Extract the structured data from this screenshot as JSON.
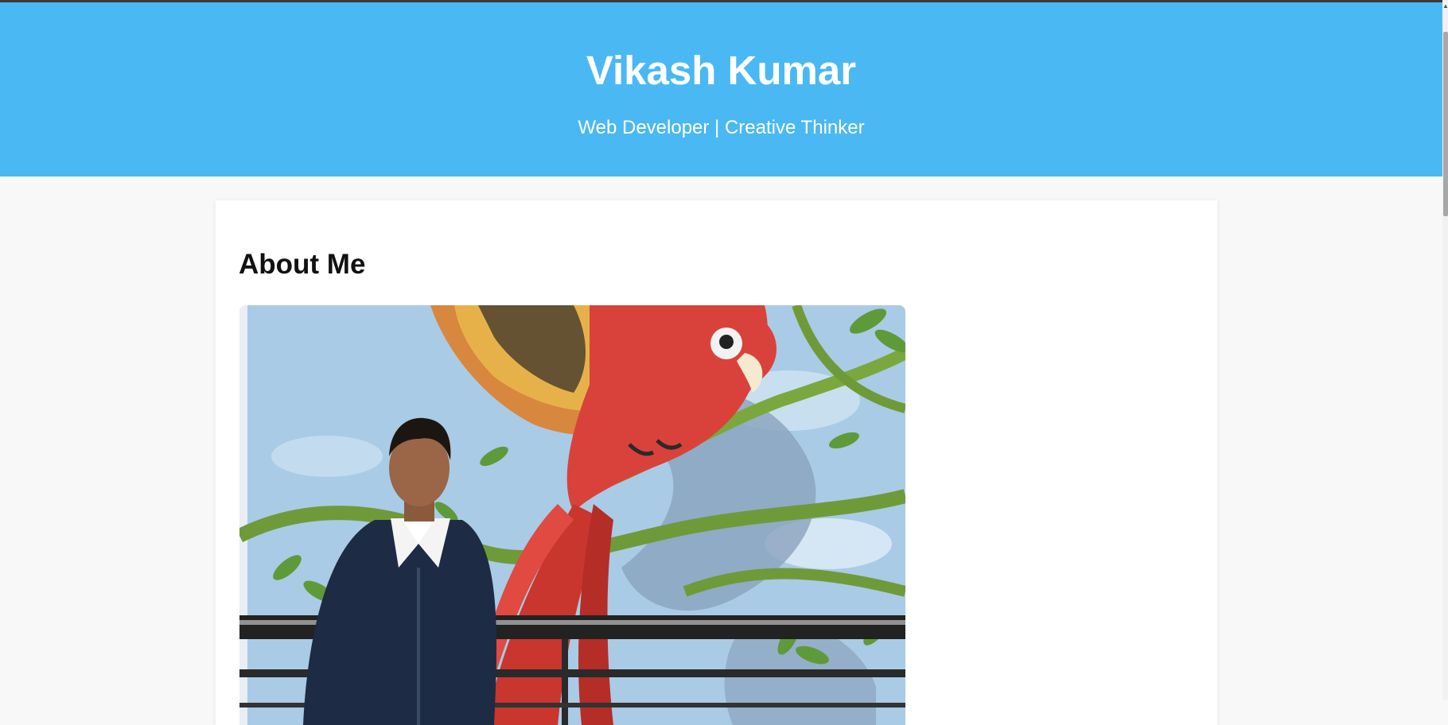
{
  "header": {
    "name": "Vikash Kumar",
    "tagline": "Web Developer | Creative Thinker",
    "background_color": "#4ab8f3"
  },
  "about": {
    "heading": "About Me",
    "photo_icon": "profile-photo"
  }
}
